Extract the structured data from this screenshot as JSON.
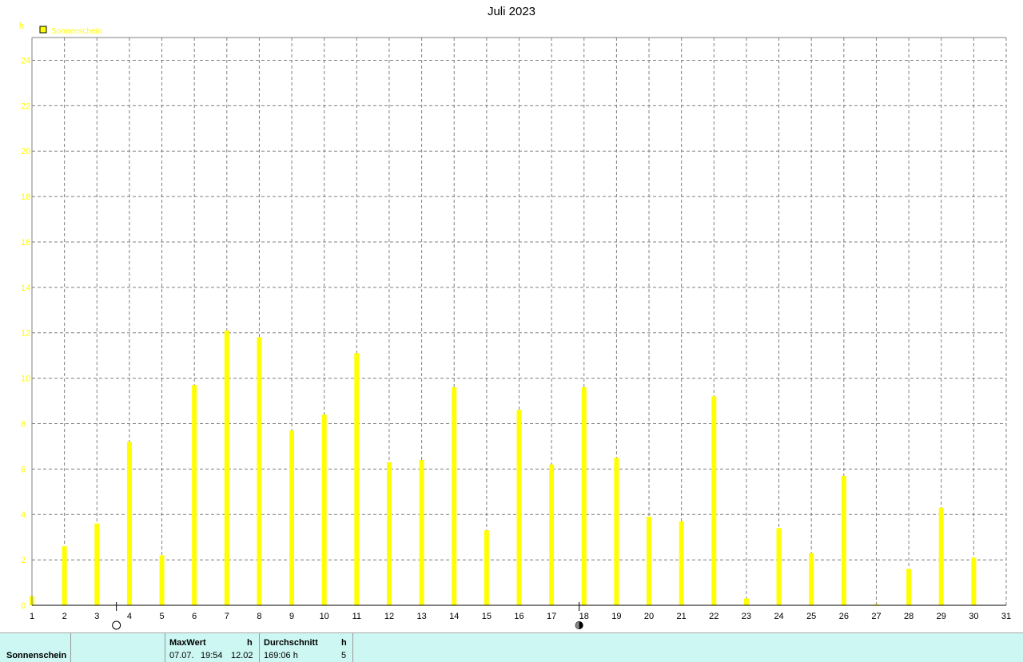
{
  "chart_data": {
    "type": "bar",
    "title": "Juli 2023",
    "ylabel": "h",
    "xlabel": "",
    "ylim": [
      0,
      25
    ],
    "yticks": [
      0,
      2,
      4,
      6,
      8,
      10,
      12,
      14,
      16,
      18,
      20,
      22,
      24
    ],
    "categories": [
      "1",
      "2",
      "3",
      "4",
      "5",
      "6",
      "7",
      "8",
      "9",
      "10",
      "11",
      "12",
      "13",
      "14",
      "15",
      "16",
      "17",
      "18",
      "19",
      "20",
      "21",
      "22",
      "23",
      "24",
      "25",
      "26",
      "27",
      "28",
      "29",
      "30",
      "31"
    ],
    "series": [
      {
        "name": "Sonnenschein",
        "color": "#ffff00",
        "values": [
          0.4,
          2.6,
          3.6,
          7.2,
          2.2,
          9.7,
          12.1,
          11.8,
          7.7,
          8.4,
          11.1,
          6.3,
          6.4,
          9.6,
          3.3,
          8.6,
          6.2,
          9.6,
          6.5,
          3.9,
          3.7,
          9.2,
          0.3,
          3.4,
          2.3,
          5.7,
          0.05,
          1.6,
          4.3,
          2.1,
          0.0
        ]
      }
    ],
    "moon_phases": [
      {
        "phase": "full-moon",
        "day": 3.6
      },
      {
        "phase": "last-quarter",
        "day": 17.85
      }
    ],
    "grid": true,
    "legend": "top-left",
    "axis_color": "#ffff00"
  },
  "footer": {
    "series_label": "Sonnenschein",
    "max_header": "MaxWert",
    "max_unit": "h",
    "max_date": "07.07.",
    "max_time": "19:54",
    "max_value": "12.02",
    "avg_header": "Durchschnitt",
    "avg_unit": "h",
    "avg_value": "169:06 h",
    "avg_extra": "5"
  }
}
